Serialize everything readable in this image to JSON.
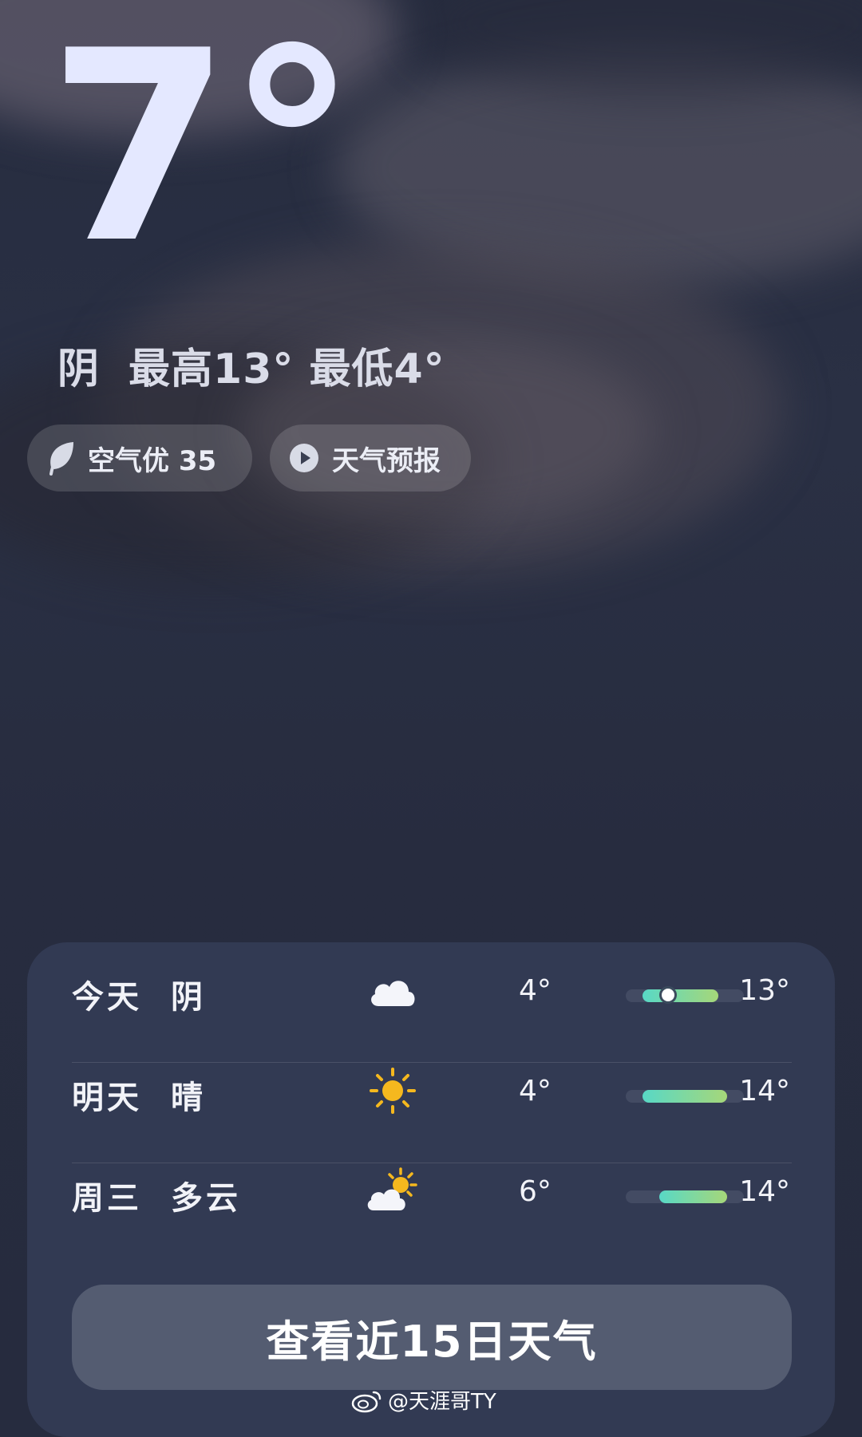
{
  "current": {
    "temperature": "7°",
    "condition": "阴",
    "high_low": "最高13° 最低4°"
  },
  "chips": {
    "air_quality": "空气优 35",
    "air_icon": "leaf-icon",
    "forecast": "天气预报",
    "forecast_icon": "play-icon"
  },
  "daily": [
    {
      "day": "今天",
      "condition": "阴",
      "icon": "cloud-icon",
      "low": "4°",
      "high": "13°",
      "range": [
        4,
        13
      ],
      "current": 7
    },
    {
      "day": "明天",
      "condition": "晴",
      "icon": "sun-icon",
      "low": "4°",
      "high": "14°",
      "range": [
        4,
        14
      ]
    },
    {
      "day": "周三",
      "condition": "多云",
      "icon": "partly-cloudy-icon",
      "low": "6°",
      "high": "14°",
      "range": [
        6,
        14
      ]
    }
  ],
  "more_button": "查看近15日天气",
  "watermark": "@天涯哥TY",
  "colors": {
    "bar_start": "#58d8c6",
    "bar_end": "#a6d779",
    "sun": "#f5b81e"
  }
}
